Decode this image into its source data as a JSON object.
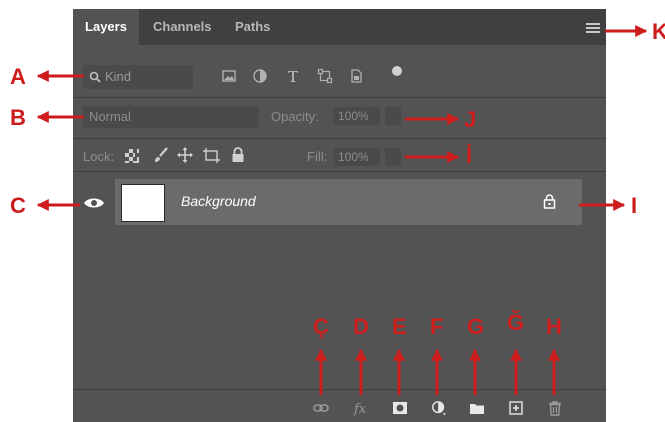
{
  "tabs": {
    "layers": "Layers",
    "channels": "Channels",
    "paths": "Paths"
  },
  "filter": {
    "kind_placeholder": "Kind"
  },
  "blend": {
    "mode": "Normal",
    "opacity_label": "Opacity:",
    "opacity_value": "100%"
  },
  "lock": {
    "label": "Lock:",
    "fill_label": "Fill:",
    "fill_value": "100%"
  },
  "layer": {
    "name": "Background"
  },
  "callouts": {
    "A": "A",
    "B": "B",
    "C": "C",
    "I": "I",
    "J": "J",
    "K": "K",
    "C_cedilla": "Ç",
    "D": "D",
    "E": "E",
    "F": "F",
    "G": "G",
    "G_breve": "Ğ",
    "H": "H",
    "I_dot": "İ"
  },
  "colors": {
    "accent": "#cc1c1c",
    "panel": "#535353",
    "tabbar": "#404040",
    "layer_row": "#6b6b6b"
  },
  "icons": [
    "search-icon",
    "image-filter-icon",
    "adjustment-filter-icon",
    "type-filter-icon",
    "shape-filter-icon",
    "smart-object-filter-icon",
    "filter-toggle-icon",
    "lock-transparent-icon",
    "lock-paint-icon",
    "lock-position-icon",
    "lock-artboard-icon",
    "lock-all-icon",
    "visibility-eye-icon",
    "layer-lock-icon",
    "link-layers-icon",
    "fx-icon",
    "add-mask-icon",
    "adjustment-layer-icon",
    "new-group-icon",
    "new-layer-icon",
    "delete-layer-icon",
    "panel-menu-icon"
  ]
}
